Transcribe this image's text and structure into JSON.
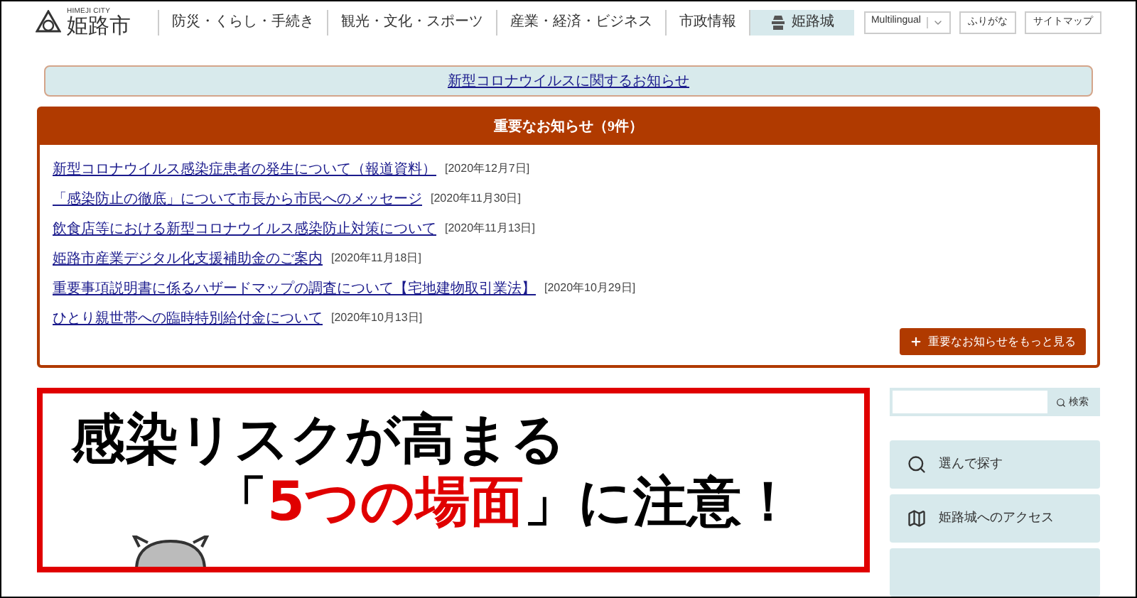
{
  "logo": {
    "caption": "HIMEJI CITY",
    "name": "姫路市"
  },
  "nav": [
    {
      "label": "防災・くらし・手続き",
      "selected": false,
      "kind": "text"
    },
    {
      "label": "観光・文化・スポーツ",
      "selected": false,
      "kind": "text"
    },
    {
      "label": "産業・経済・ビジネス",
      "selected": false,
      "kind": "text"
    },
    {
      "label": "市政情報",
      "selected": false,
      "kind": "text"
    },
    {
      "label": "姫路城",
      "selected": true,
      "kind": "castle"
    }
  ],
  "utility": {
    "language": "Multilingual",
    "buttons": [
      "ふりがな",
      "サイトマップ"
    ]
  },
  "corona_link": "新型コロナウイルスに関するお知らせ",
  "notices": {
    "title": "重要なお知らせ（9件）",
    "items": [
      {
        "title": "新型コロナウイルス感染症患者の発生について（報道資料）",
        "date": "[2020年12月7日]"
      },
      {
        "title": "「感染防止の徹底」について市長から市民へのメッセージ",
        "date": "[2020年11月30日]"
      },
      {
        "title": "飲食店等における新型コロナウイルス感染防止対策について",
        "date": "[2020年11月13日]"
      },
      {
        "title": "姫路市産業デジタル化支援補助金のご案内",
        "date": "[2020年11月18日]"
      },
      {
        "title": "重要事項説明書に係るハザードマップの調査について【宅地建物取引業法】",
        "date": "[2020年10月29日]"
      },
      {
        "title": "ひとり親世帯への臨時特別給付金について",
        "date": "[2020年10月13日]"
      }
    ],
    "more_button": "重要なお知らせをもっと見る"
  },
  "banner": {
    "line_1": "感染リスクが高まる",
    "line_2_before": "「",
    "line_2_highlight": "5つの場面",
    "line_2_after": "」に注意！"
  },
  "sidebar": {
    "search_button": "検索",
    "links": [
      {
        "label": "選んで探す",
        "kind": "search"
      },
      {
        "label": "姫路城へのアクセス",
        "kind": "map"
      }
    ]
  }
}
